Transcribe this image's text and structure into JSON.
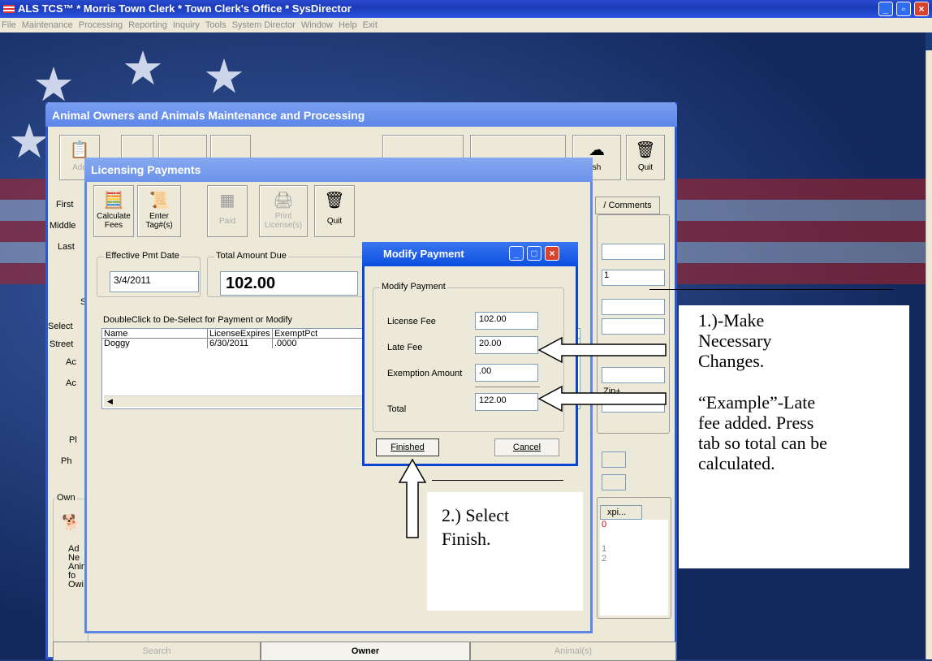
{
  "app": {
    "title": "ALS TCS™ * Morris Town Clerk * Town Clerk's Office * SysDirector"
  },
  "menu": [
    "File",
    "Maintenance",
    "Processing",
    "Reporting",
    "Inquiry",
    "Tools",
    "System Director",
    "Window",
    "Help",
    "Exit"
  ],
  "main_window": {
    "title": "Animal Owners and Animals Maintenance and Processing",
    "toolbar": {
      "add": "Add",
      "finish": "sh",
      "quit": "Quit"
    },
    "comments_tab": "/ Comments",
    "left_labels": [
      "First",
      "Middle",
      "Last",
      "S",
      "Select",
      "Street",
      "Ac",
      "Ac",
      "Pl",
      "Ph"
    ],
    "owner_group": "Own",
    "add_new_lines": [
      "Ad",
      "Ne",
      "Anin",
      "fo",
      "Owi"
    ],
    "zip_label": "Zip+",
    "field_value": "1",
    "list_header": "xpi...",
    "list_vals": [
      "0",
      "1",
      "2"
    ],
    "bottom_tabs": [
      "Search",
      "Owner",
      "Animal(s)"
    ]
  },
  "licensing_window": {
    "title": "Licensing Payments",
    "toolbar": [
      {
        "label1": "Calculate",
        "label2": "Fees"
      },
      {
        "label1": "Enter",
        "label2": "Tag#(s)"
      },
      {
        "label1": "Paid",
        "label2": ""
      },
      {
        "label1": "Print",
        "label2": "License(s)"
      },
      {
        "label1": "Quit",
        "label2": ""
      }
    ],
    "effective_pmt_date_label": "Effective Pmt Date",
    "effective_pmt_date": "3/4/2011",
    "total_amount_due_label": "Total Amount Due",
    "total_amount_due": "102.00",
    "grid_title": "DoubleClick to De-Select for Payment or Modify",
    "grid_headers": [
      "Name",
      "LicenseExpires",
      "ExemptPct"
    ],
    "grid_row": [
      "Doggy",
      "6/30/2011",
      ".0000"
    ]
  },
  "modify_window": {
    "title": "Modify Payment",
    "group_label": "Modify Payment",
    "license_fee_label": "License Fee",
    "license_fee": "102.00",
    "late_fee_label": "Late Fee",
    "late_fee": "20.00",
    "exemption_label": "Exemption Amount",
    "exemption": ".00",
    "total_label": "Total",
    "total": "122.00",
    "finished": "Finished",
    "cancel": "Cancel"
  },
  "callouts": {
    "step1": [
      "1.)-Make",
      "Necessary",
      "Changes."
    ],
    "example": [
      "“Example”-Late",
      "fee added. Press",
      "tab so total can be",
      "calculated."
    ],
    "step2": [
      "2.) Select",
      "Finish."
    ]
  }
}
